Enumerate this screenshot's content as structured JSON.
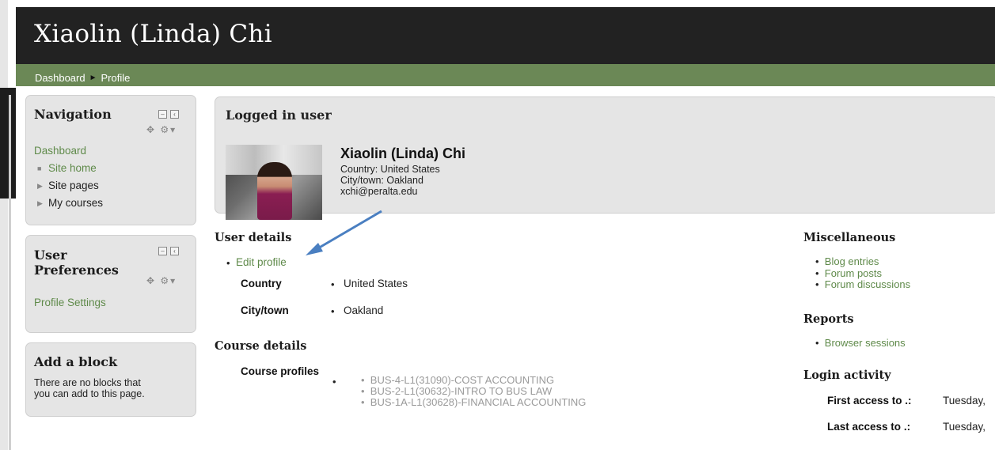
{
  "header": {
    "title": "Xiaolin (Linda) Chi"
  },
  "breadcrumb": {
    "items": [
      "Dashboard",
      "Profile"
    ],
    "separator": "►"
  },
  "navigation": {
    "title": "Navigation",
    "top_link": "Dashboard",
    "items": [
      "Site home",
      "Site pages",
      "My courses"
    ]
  },
  "user_prefs": {
    "title": "User Preferences",
    "title_line1": "User",
    "title_line2": "Preferences",
    "link": "Profile Settings"
  },
  "add_block": {
    "title": "Add a block",
    "message_line1": "There are no blocks that",
    "message_line2": "you can add to this page."
  },
  "logged_in": {
    "title": "Logged in user",
    "name": "Xiaolin (Linda) Chi",
    "country": "Country: United States",
    "city": "City/town: Oakland",
    "email": "xchi@peralta.edu"
  },
  "user_details": {
    "title": "User details",
    "edit_link": "Edit profile",
    "country_label": "Country",
    "country_value": "United States",
    "city_label": "City/town",
    "city_value": "Oakland"
  },
  "course_details": {
    "title": "Course details",
    "profiles_label": "Course profiles",
    "courses": [
      "BUS-4-L1(31090)-COST ACCOUNTING",
      "BUS-2-L1(30632)-INTRO TO BUS LAW",
      "BUS-1A-L1(30628)-FINANCIAL ACCOUNTING"
    ]
  },
  "misc": {
    "title": "Miscellaneous",
    "links": [
      "Blog entries",
      "Forum posts",
      "Forum discussions"
    ]
  },
  "reports": {
    "title": "Reports",
    "links": [
      "Browser sessions"
    ]
  },
  "login_activity": {
    "title": "Login activity",
    "first_label": "First access to",
    "first_value": "Tuesday,",
    "last_label": "Last access to",
    "last_value": "Tuesday,"
  },
  "colors": {
    "header_bg": "#222222",
    "breadcrumb_bg": "#6b8856",
    "link": "#5f8a4a",
    "arrow": "#4a7fc1"
  }
}
